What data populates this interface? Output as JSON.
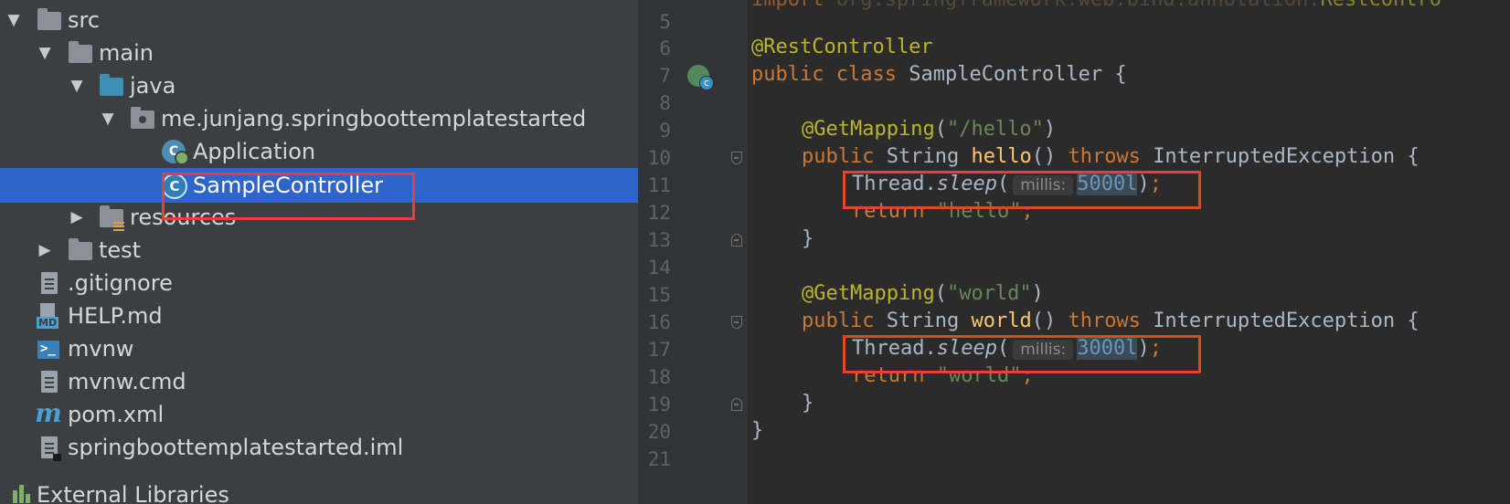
{
  "tree": {
    "items": [
      {
        "label": "src",
        "icon": "folder-icon",
        "arrow": "▼",
        "expanded": true
      },
      {
        "label": "main",
        "icon": "folder-icon",
        "arrow": "▼",
        "expanded": true
      },
      {
        "label": "java",
        "icon": "source-folder-icon",
        "arrow": "▼",
        "expanded": true
      },
      {
        "label": "me.junjang.springboottemplatestarted",
        "icon": "package-icon",
        "arrow": "▼",
        "expanded": true
      },
      {
        "label": "Application",
        "icon": "spring-boot-class-icon",
        "class_letter": "C"
      },
      {
        "label": "SampleController",
        "icon": "class-icon",
        "class_letter": "C",
        "selected": true
      },
      {
        "label": "resources",
        "icon": "resources-folder-icon",
        "arrow": "▶",
        "expanded": false
      },
      {
        "label": "test",
        "icon": "folder-icon",
        "arrow": "▶",
        "expanded": false
      },
      {
        "label": ".gitignore",
        "icon": "text-file-icon"
      },
      {
        "label": "HELP.md",
        "icon": "markdown-file-icon",
        "tag": "MD"
      },
      {
        "label": "mvnw",
        "icon": "shell-script-icon",
        "symbol": ">_"
      },
      {
        "label": "mvnw.cmd",
        "icon": "text-file-icon"
      },
      {
        "label": "pom.xml",
        "icon": "maven-icon",
        "symbol": "m"
      },
      {
        "label": "springboottemplatestarted.iml",
        "icon": "module-file-icon"
      },
      {
        "label": "External Libraries",
        "icon": "libraries-icon",
        "partially_visible": true
      }
    ]
  },
  "editor": {
    "top_partial": {
      "prefix": "import ",
      "text": "org.springframework.web.bind.annotation.",
      "suffix": "RestContro"
    },
    "line_numbers": [
      "5",
      "6",
      "7",
      "8",
      "9",
      "10",
      "11",
      "12",
      "13",
      "14",
      "15",
      "16",
      "17",
      "18",
      "19",
      "20",
      "21"
    ],
    "lines": {
      "l6": {
        "annotation": "@RestController"
      },
      "l7": {
        "kw1": "public",
        "kw2": "class",
        "name": "SampleController",
        "brace": " {"
      },
      "l9": {
        "annotation": "@GetMapping",
        "open": "(",
        "str": "\"/hello\"",
        "close": ")"
      },
      "l10": {
        "kw1": "public",
        "type": "String",
        "method": "hello",
        "parens": "()",
        "kw2": "throws",
        "exc": "InterruptedException",
        "brace": " {"
      },
      "l11": {
        "cls": "Thread.",
        "call": "sleep",
        "open": "(",
        "hint": "millis:",
        "num": "5000l",
        "close": ")",
        "semi": ";"
      },
      "l12": {
        "kw": "return",
        "str": "\"hello\"",
        "semi": ";"
      },
      "l13": {
        "brace": "}"
      },
      "l15": {
        "annotation": "@GetMapping",
        "open": "(",
        "str": "\"world\"",
        "close": ")"
      },
      "l16": {
        "kw1": "public",
        "type": "String",
        "method": "world",
        "parens": "()",
        "kw2": "throws",
        "exc": "InterruptedException",
        "brace": " {"
      },
      "l17": {
        "cls": "Thread.",
        "call": "sleep",
        "open": "(",
        "hint": "millis:",
        "num": "3000l",
        "close": ")",
        "semi": ";"
      },
      "l18": {
        "kw": "return",
        "str": "\"world\"",
        "semi": ";"
      },
      "l19": {
        "brace": "}"
      },
      "l20": {
        "brace": "}"
      }
    }
  },
  "colors": {
    "tree_bg": "#3c3f41",
    "selection": "#2f65ca",
    "editor_bg": "#2b2b2b",
    "gutter_bg": "#313335",
    "keyword": "#cc7832",
    "annotation": "#bbb529",
    "string": "#6a8759",
    "number": "#6897bb",
    "method_decl": "#ffc66d",
    "highlight_box": "#e5432e"
  }
}
